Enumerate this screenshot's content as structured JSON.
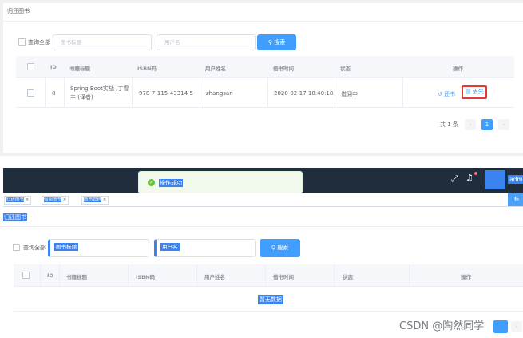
{
  "panel1": {
    "title": "归还图书",
    "search_all": "查询全部",
    "title_placeholder": "图书标题",
    "username_placeholder": "用户名",
    "search_button": "搜索",
    "columns": [
      "ID",
      "书籍标题",
      "ISBN码",
      "用户姓名",
      "借书时间",
      "状态",
      "操作"
    ],
    "row": {
      "id": "8",
      "title_line1": "Spring Boot实战 ,丁雪",
      "title_line2": "丰 (译者)",
      "isbn": "978-7-115-43314-5",
      "username": "zhangsan",
      "borrow_time": "2020-02-17 18:40:18",
      "status": "借阅中",
      "action_return": "还书",
      "action_lost": "丢失"
    },
    "pager": {
      "total": "共 1 条",
      "current": "1"
    }
  },
  "panel2": {
    "toast": "操作成功",
    "user": "admin",
    "tags": [
      "归还图书",
      "借阅图书",
      "图书管理"
    ],
    "right_tab": "标签",
    "page_title": "归还图书",
    "search_all": "查询全部",
    "title_placeholder": "图书标题",
    "username_placeholder": "用户名",
    "search_button": "搜索",
    "columns": [
      "ID",
      "书籍标题",
      "ISBN码",
      "用户姓名",
      "借书时间",
      "状态",
      "操作"
    ],
    "empty_text": "暂无数据",
    "watermark": "CSDN @陶然同学"
  },
  "colors": {
    "primary": "#409eff",
    "navbar": "#1f2d3d",
    "success": "#67c23a",
    "danger": "#e53935",
    "selection": "#3b83f0"
  },
  "icons": [
    "search-icon",
    "return-icon",
    "lost-icon",
    "fullscreen-icon",
    "bell-icon",
    "close-icon",
    "success-icon",
    "chevron-left-icon",
    "chevron-right-icon"
  ]
}
